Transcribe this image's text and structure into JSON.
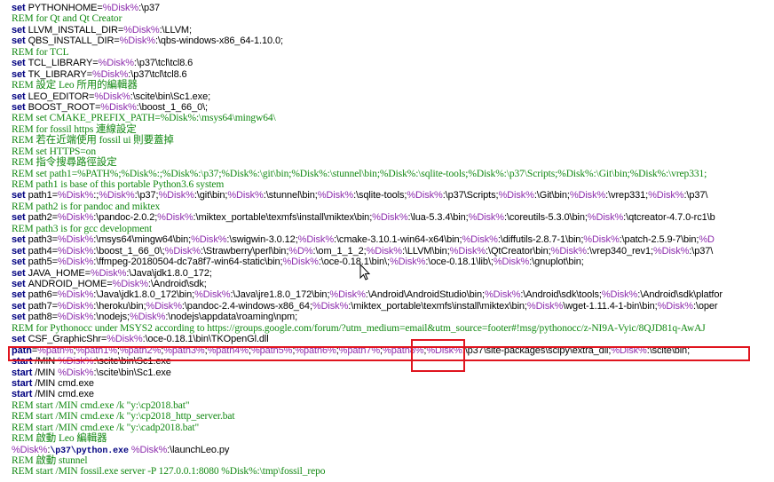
{
  "lines": [
    {
      "kind": "set",
      "name": "PYTHONHOME=",
      "rest": [
        [
          "v",
          "%Disk%"
        ],
        [
          "t",
          ":\\p37"
        ]
      ]
    },
    {
      "kind": "rem",
      "text": "REM for Qt and Qt Creator"
    },
    {
      "kind": "set",
      "name": "LLVM_INSTALL_DIR=",
      "rest": [
        [
          "v",
          "%Disk%"
        ],
        [
          "t",
          ":\\LLVM;"
        ]
      ]
    },
    {
      "kind": "set",
      "name": "QBS_INSTALL_DIR=",
      "rest": [
        [
          "v",
          "%Disk%"
        ],
        [
          "t",
          ":\\qbs-windows-x86_64-1.10.0;"
        ]
      ]
    },
    {
      "kind": "rem",
      "text": "REM for TCL"
    },
    {
      "kind": "set",
      "name": "TCL_LIBRARY=",
      "rest": [
        [
          "v",
          "%Disk%"
        ],
        [
          "t",
          ":\\p37\\tcl\\tcl8.6"
        ]
      ]
    },
    {
      "kind": "set",
      "name": "TK_LIBRARY=",
      "rest": [
        [
          "v",
          "%Disk%"
        ],
        [
          "t",
          ":\\p37\\tcl\\tcl8.6"
        ]
      ]
    },
    {
      "kind": "rem",
      "text": "REM 設定 Leo 所用的編輯器"
    },
    {
      "kind": "set",
      "name": "LEO_EDITOR=",
      "rest": [
        [
          "v",
          "%Disk%"
        ],
        [
          "t",
          ":\\scite\\bin\\Sc1.exe;"
        ]
      ]
    },
    {
      "kind": "set",
      "name": "BOOST_ROOT=",
      "rest": [
        [
          "v",
          "%Disk%"
        ],
        [
          "t",
          ":\\boost_1_66_0\\;"
        ]
      ]
    },
    {
      "kind": "rem",
      "text": "REM set CMAKE_PREFIX_PATH=%Disk%:\\msys64\\mingw64\\"
    },
    {
      "kind": "rem",
      "text": "REM for fossil https 連線設定"
    },
    {
      "kind": "rem",
      "text": "REM 若在近端使用 fossil ui 則要蓋掉"
    },
    {
      "kind": "rem",
      "text": "REM set HTTPS=on"
    },
    {
      "kind": "rem",
      "text": "REM 指令搜尋路徑設定"
    },
    {
      "kind": "rem",
      "text": "REM set path1=%PATH%;%Disk%:;%Disk%:\\p37;%Disk%:\\git\\bin;%Disk%:\\stunnel\\bin;%Disk%:\\sqlite-tools;%Disk%:\\p37\\Scripts;%Disk%:\\Git\\bin;%Disk%:\\vrep331;"
    },
    {
      "kind": "rem",
      "text": "REM path1 is base of this portable Python3.6 system"
    },
    {
      "kind": "set",
      "name": "path1=",
      "rest": [
        [
          "v",
          "%Disk%"
        ],
        [
          "t",
          ":;"
        ],
        [
          "v",
          "%Disk%"
        ],
        [
          "t",
          ":\\p37;"
        ],
        [
          "v",
          "%Disk%"
        ],
        [
          "t",
          ":\\git\\bin;"
        ],
        [
          "v",
          "%Disk%"
        ],
        [
          "t",
          ":\\stunnel\\bin;"
        ],
        [
          "v",
          "%Disk%"
        ],
        [
          "t",
          ":\\sqlite-tools;"
        ],
        [
          "v",
          "%Disk%"
        ],
        [
          "t",
          ":\\p37\\Scripts;"
        ],
        [
          "v",
          "%Disk%"
        ],
        [
          "t",
          ":\\Git\\bin;"
        ],
        [
          "v",
          "%Disk%"
        ],
        [
          "t",
          ":\\vrep331;"
        ],
        [
          "v",
          "%Disk%"
        ],
        [
          "t",
          ":\\p37\\"
        ]
      ]
    },
    {
      "kind": "rem",
      "text": "REM path2 is for pandoc and miktex"
    },
    {
      "kind": "set",
      "name": "path2=",
      "rest": [
        [
          "v",
          "%Disk%"
        ],
        [
          "t",
          ":\\pandoc-2.0.2;"
        ],
        [
          "v",
          "%Disk%"
        ],
        [
          "t",
          ":\\miktex_portable\\texmfs\\install\\miktex\\bin;"
        ],
        [
          "v",
          "%Disk%"
        ],
        [
          "t",
          ":\\lua-5.3.4\\bin;"
        ],
        [
          "v",
          "%Disk%"
        ],
        [
          "t",
          ":\\coreutils-5.3.0\\bin;"
        ],
        [
          "v",
          "%Disk%"
        ],
        [
          "t",
          ":\\qtcreator-4.7.0-rc1\\b"
        ]
      ]
    },
    {
      "kind": "rem",
      "text": "REM path3 is for gcc development"
    },
    {
      "kind": "set",
      "name": "path3=",
      "rest": [
        [
          "v",
          "%Disk%"
        ],
        [
          "t",
          ":\\msys64\\mingw64\\bin;"
        ],
        [
          "v",
          "%Disk%"
        ],
        [
          "t",
          ":\\swigwin-3.0.12;"
        ],
        [
          "v",
          "%Disk%"
        ],
        [
          "t",
          ":\\cmake-3.10.1-win64-x64\\bin;"
        ],
        [
          "v",
          "%Disk%"
        ],
        [
          "t",
          ":\\diffutils-2.8.7-1\\bin;"
        ],
        [
          "v",
          "%Disk%"
        ],
        [
          "t",
          ":\\patch-2.5.9-7\\bin;"
        ],
        [
          "v",
          "%D"
        ]
      ]
    },
    {
      "kind": "set",
      "name": "path4=",
      "rest": [
        [
          "v",
          "%Disk%"
        ],
        [
          "t",
          ":\\boost_1_66_0\\;"
        ],
        [
          "v",
          "%Disk%"
        ],
        [
          "t",
          ":\\Strawberry\\perl\\bin;"
        ],
        [
          "v",
          "%D%"
        ],
        [
          "t",
          ":\\om_1_1_2;"
        ],
        [
          "v",
          "%Disk%"
        ],
        [
          "t",
          ":\\LLVM\\bin;"
        ],
        [
          "v",
          "%Disk%"
        ],
        [
          "t",
          ":\\QtCreator\\bin;"
        ],
        [
          "v",
          "%Disk%"
        ],
        [
          "t",
          ":\\vrep340_rev1;"
        ],
        [
          "v",
          "%Disk%"
        ],
        [
          "t",
          ":\\p37\\"
        ]
      ]
    },
    {
      "kind": "set",
      "name": "path5=",
      "rest": [
        [
          "v",
          "%Disk%"
        ],
        [
          "t",
          ":\\ffmpeg-20180504-dc7a8f7-win64-static\\bin;"
        ],
        [
          "v",
          "%Disk%"
        ],
        [
          "t",
          ":\\oce-0.18.1\\bin\\;"
        ],
        [
          "v",
          "%Disk%"
        ],
        [
          "t",
          ":\\oce-0.18.1\\lib\\;"
        ],
        [
          "v",
          "%Disk%"
        ],
        [
          "t",
          ":\\gnuplot\\bin;"
        ]
      ]
    },
    {
      "kind": "set",
      "name": "JAVA_HOME=",
      "rest": [
        [
          "v",
          "%Disk%"
        ],
        [
          "t",
          ":\\Java\\jdk1.8.0_172;"
        ]
      ]
    },
    {
      "kind": "set",
      "name": "ANDROID_HOME=",
      "rest": [
        [
          "v",
          "%Disk%"
        ],
        [
          "t",
          ":\\Android\\sdk;"
        ]
      ]
    },
    {
      "kind": "set",
      "name": "path6=",
      "rest": [
        [
          "v",
          "%Disk%"
        ],
        [
          "t",
          ":\\Java\\jdk1.8.0_172\\bin;"
        ],
        [
          "v",
          "%Disk%"
        ],
        [
          "t",
          ":\\Java\\jre1.8.0_172\\bin;"
        ],
        [
          "v",
          "%Disk%"
        ],
        [
          "t",
          ":\\Android\\AndroidStudio\\bin;"
        ],
        [
          "v",
          "%Disk%"
        ],
        [
          "t",
          ":\\Android\\sdk\\tools;"
        ],
        [
          "v",
          "%Disk%"
        ],
        [
          "t",
          ":\\Android\\sdk\\platfor"
        ]
      ]
    },
    {
      "kind": "set",
      "name": "path7=",
      "rest": [
        [
          "v",
          "%Disk%"
        ],
        [
          "t",
          ":\\heroku\\bin;"
        ],
        [
          "v",
          "%Disk%"
        ],
        [
          "t",
          ":\\pandoc-2.4-windows-x86_64;"
        ],
        [
          "v",
          "%Disk%"
        ],
        [
          "t",
          ":\\miktex_portable\\texmfs\\install\\miktex\\bin;"
        ],
        [
          "v",
          "%Disk%"
        ],
        [
          "t",
          "\\wget-1.11.4-1-bin\\bin;"
        ],
        [
          "v",
          "%Disk%"
        ],
        [
          "t",
          ":\\oper"
        ]
      ]
    },
    {
      "kind": "set",
      "name": "path8=",
      "rest": [
        [
          "v",
          "%Disk%"
        ],
        [
          "t",
          ":\\nodejs;"
        ],
        [
          "v",
          "%Disk%"
        ],
        [
          "t",
          ":\\nodejs\\appdata\\roaming\\npm;"
        ]
      ]
    },
    {
      "kind": "rem",
      "text": "REM for Pythonocc under MSYS2 according to https://groups.google.com/forum/?utm_medium=email&utm_source=footer#!msg/pythonocc/z-NI9A-Vyic/8QJD81q-AwAJ"
    },
    {
      "kind": "set",
      "name": "CSF_GraphicShr=",
      "rest": [
        [
          "v",
          "%Disk%"
        ],
        [
          "t",
          ":\\oce-0.18.1\\bin\\TKOpenGl.dll"
        ]
      ]
    },
    {
      "kind": "setpath",
      "rest": [
        [
          "k",
          "path"
        ],
        [
          "t",
          "="
        ],
        [
          "v",
          "%path%"
        ],
        [
          "t",
          ";"
        ],
        [
          "v",
          "%path1%"
        ],
        [
          "t",
          ";"
        ],
        [
          "v",
          "%path2%"
        ],
        [
          "t",
          ";"
        ],
        [
          "v",
          "%path3%"
        ],
        [
          "t",
          ";"
        ],
        [
          "v",
          "%path4%"
        ],
        [
          "t",
          ";"
        ],
        [
          "v",
          "%path5%"
        ],
        [
          "t",
          ";"
        ],
        [
          "v",
          "%path6%"
        ],
        [
          "t",
          ";"
        ],
        [
          "v",
          "%path7%"
        ],
        [
          "t",
          ";"
        ],
        [
          "v",
          "%path8%"
        ],
        [
          "t",
          ";"
        ],
        [
          "v",
          "%Disk%"
        ],
        [
          "t",
          ":\\p37\\site-packages\\scipy\\extra_dll;"
        ],
        [
          "v",
          "%Disk%"
        ],
        [
          "t",
          ":\\scite\\bin;"
        ]
      ]
    },
    {
      "kind": "cmd",
      "rest": [
        [
          "k",
          "start"
        ],
        [
          "t",
          " /MIN "
        ],
        [
          "v",
          "%Disk%"
        ],
        [
          "t",
          ":\\scite\\bin\\Sc1.exe"
        ]
      ]
    },
    {
      "kind": "cmd",
      "rest": [
        [
          "k",
          "start"
        ],
        [
          "t",
          " /MIN "
        ],
        [
          "v",
          "%Disk%"
        ],
        [
          "t",
          ":\\scite\\bin\\Sc1.exe"
        ]
      ]
    },
    {
      "kind": "cmd",
      "rest": [
        [
          "k",
          "start"
        ],
        [
          "t",
          " /MIN cmd.exe"
        ]
      ]
    },
    {
      "kind": "cmd",
      "rest": [
        [
          "k",
          "start"
        ],
        [
          "t",
          " /MIN cmd.exe"
        ]
      ]
    },
    {
      "kind": "rem",
      "text": "REM start /MIN cmd.exe /k \"y:\\cp2018.bat\""
    },
    {
      "kind": "rem",
      "text": "REM start /MIN cmd.exe /k \"y:\\cp2018_http_server.bat"
    },
    {
      "kind": "rem",
      "text": "REM start /MIN cmd.exe /k \"y:\\cadp2018.bat\""
    },
    {
      "kind": "rem",
      "text": "REM 啟動 Leo 編輯器"
    },
    {
      "kind": "cmd",
      "rest": [
        [
          "v",
          "%Disk%"
        ],
        [
          "t",
          ":"
        ],
        [
          "m",
          "\\p37\\python.exe"
        ],
        [
          "t",
          " "
        ],
        [
          "v",
          "%Disk%"
        ],
        [
          "t",
          ":\\launchLeo.py"
        ]
      ]
    },
    {
      "kind": "rem",
      "text": "REM 啟動 stunnel"
    },
    {
      "kind": "rem",
      "text": "REM start /MIN fossil.exe server -P 127.0.0.1:8080 %Disk%:\\tmp\\fossil_repo"
    }
  ]
}
